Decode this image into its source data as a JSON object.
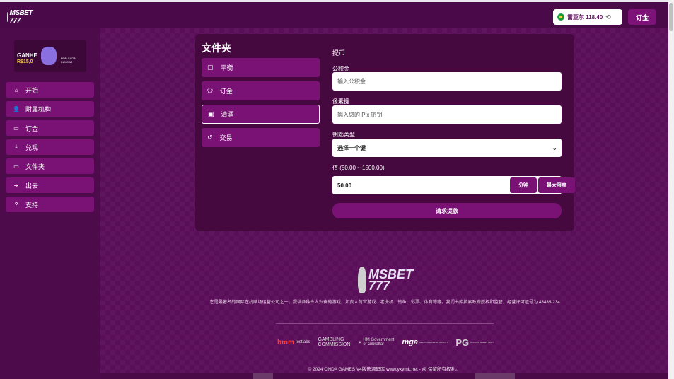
{
  "header": {
    "logo_text": "MSBET 777",
    "balance_label": "雷亚尔 118.40",
    "deposit_label": "订金",
    "icons": {
      "flag": "brazil-flag-icon",
      "refresh": "refresh-icon"
    }
  },
  "sidebar": {
    "banner": {
      "line1": "GANHE",
      "line2": "R$15,0",
      "line3": "POR CADA",
      "line4": "INDICAR"
    },
    "items": [
      {
        "label": "开始",
        "icon": "home-icon"
      },
      {
        "label": "附属机构",
        "icon": "users-icon"
      },
      {
        "label": "订金",
        "icon": "wallet-icon"
      },
      {
        "label": "兑现",
        "icon": "download-icon"
      },
      {
        "label": "文件夹",
        "icon": "folder-icon"
      },
      {
        "label": "出去",
        "icon": "logout-icon"
      },
      {
        "label": "支持",
        "icon": "support-icon"
      }
    ]
  },
  "card": {
    "title": "文件夹",
    "tabs": [
      {
        "label": "平衡",
        "icon": "wallet-icon",
        "active": false
      },
      {
        "label": "订金",
        "icon": "piggy-bank-icon",
        "active": false
      },
      {
        "label": "清酒",
        "icon": "cash-icon",
        "active": true
      },
      {
        "label": "交易",
        "icon": "history-icon",
        "active": false
      }
    ]
  },
  "form": {
    "heading": "提币",
    "fields": [
      {
        "label": "公积金",
        "placeholder": "输入公积金"
      },
      {
        "label": "像素键",
        "placeholder": "输入您的 Pix 密钥"
      }
    ],
    "key_type": {
      "label": "钥匙类型",
      "selected": "选择一个键"
    },
    "amount": {
      "label": "值 (50.00 ~ 1500.00)",
      "value": "50.00",
      "min_label": "分钟",
      "max_label": "最大限度"
    },
    "submit_label": "请求提款"
  },
  "footer": {
    "logo_text": "MSBET 777",
    "description": "它是最著名的国际在线赌场运营公司之一，提供各种令人兴奋的游戏，如真人荷官游戏、老虎机、钓鱼、彩票、体育等等。我们由库拉索政府授权和监管，经营许可证号为 43435-234",
    "partners": [
      {
        "name": "bmm",
        "sub": "testlabs"
      },
      {
        "name": "GAMBLING",
        "sub": "COMMISSION"
      },
      {
        "name": "HM Government",
        "sub": "of Gibraltar"
      },
      {
        "name": "mga",
        "sub": "MALTA GAMING AUTHORITY"
      },
      {
        "name": "PG",
        "sub": "POCKET GAMES SOFT"
      }
    ],
    "copyright": "© 2024 ONDA GAMES V4版选源码库 www.yxymk.net - @ 保留所有权利。"
  }
}
